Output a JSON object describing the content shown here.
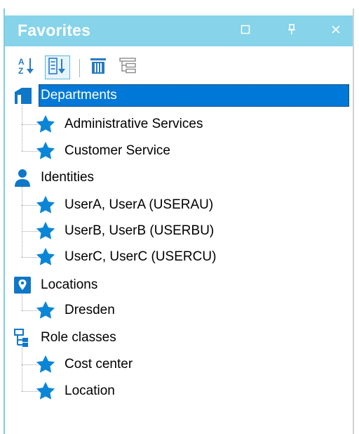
{
  "panel": {
    "title": "Favorites",
    "accent_color": "#86d3ea",
    "selection_color": "#0078d7"
  },
  "title_buttons": [
    {
      "icon": "maximize-icon"
    },
    {
      "icon": "pin-icon"
    },
    {
      "icon": "close-icon"
    }
  ],
  "toolbar": [
    {
      "icon": "sort-az-icon"
    },
    {
      "icon": "sort-list-icon",
      "active": true
    },
    {
      "icon": "delete-icon"
    },
    {
      "icon": "group-settings-icon"
    }
  ],
  "tree": [
    {
      "label": "Departments",
      "icon": "building-icon",
      "selected": true,
      "children": [
        "Administrative Services",
        "Customer Service"
      ]
    },
    {
      "label": "Identities",
      "icon": "person-icon",
      "children": [
        "UserA, UserA (USERAU)",
        "UserB, UserB (USERBU)",
        "UserC, UserC (USERCU)"
      ]
    },
    {
      "label": "Locations",
      "icon": "location-pin-icon",
      "children": [
        "Dresden"
      ]
    },
    {
      "label": "Role classes",
      "icon": "role-hierarchy-icon",
      "children": [
        "Cost center",
        "Location"
      ]
    }
  ]
}
